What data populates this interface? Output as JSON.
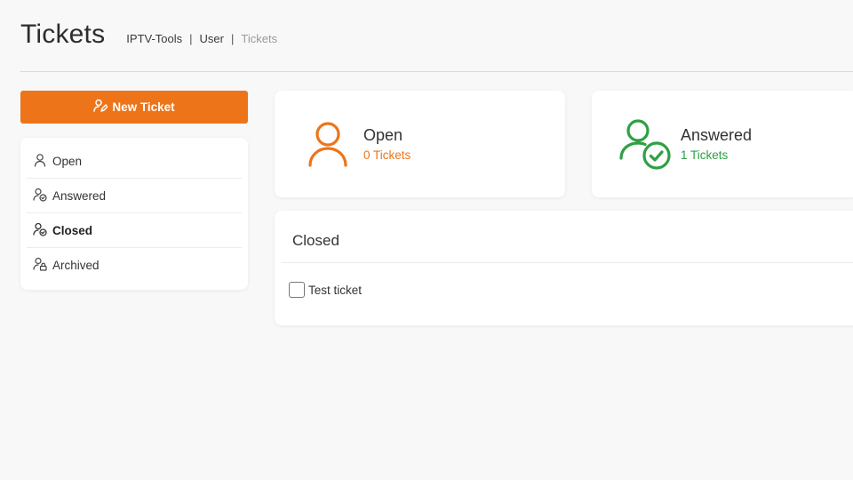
{
  "header": {
    "title": "Tickets",
    "breadcrumb": [
      {
        "label": "IPTV-Tools"
      },
      {
        "label": "User"
      },
      {
        "label": "Tickets"
      }
    ],
    "separator": "|"
  },
  "sidebar": {
    "new_ticket_label": "New Ticket",
    "items": [
      {
        "label": "Open",
        "icon": "user-icon",
        "active": false
      },
      {
        "label": "Answered",
        "icon": "user-check-icon",
        "active": false
      },
      {
        "label": "Closed",
        "icon": "user-check-icon",
        "active": true
      },
      {
        "label": "Archived",
        "icon": "user-lock-icon",
        "active": false
      }
    ]
  },
  "stats": {
    "open": {
      "title": "Open",
      "count": "0 Tickets",
      "color": "#ee7419",
      "icon": "user-icon"
    },
    "answered": {
      "title": "Answered",
      "count": "1 Tickets",
      "color": "#2ea043",
      "icon": "user-check-icon"
    }
  },
  "closed_panel": {
    "title": "Closed",
    "tickets": [
      {
        "label": "Test ticket",
        "checked": false
      }
    ]
  },
  "colors": {
    "accent": "#ee7419",
    "success": "#2ea043",
    "background": "#f8f8f8"
  }
}
